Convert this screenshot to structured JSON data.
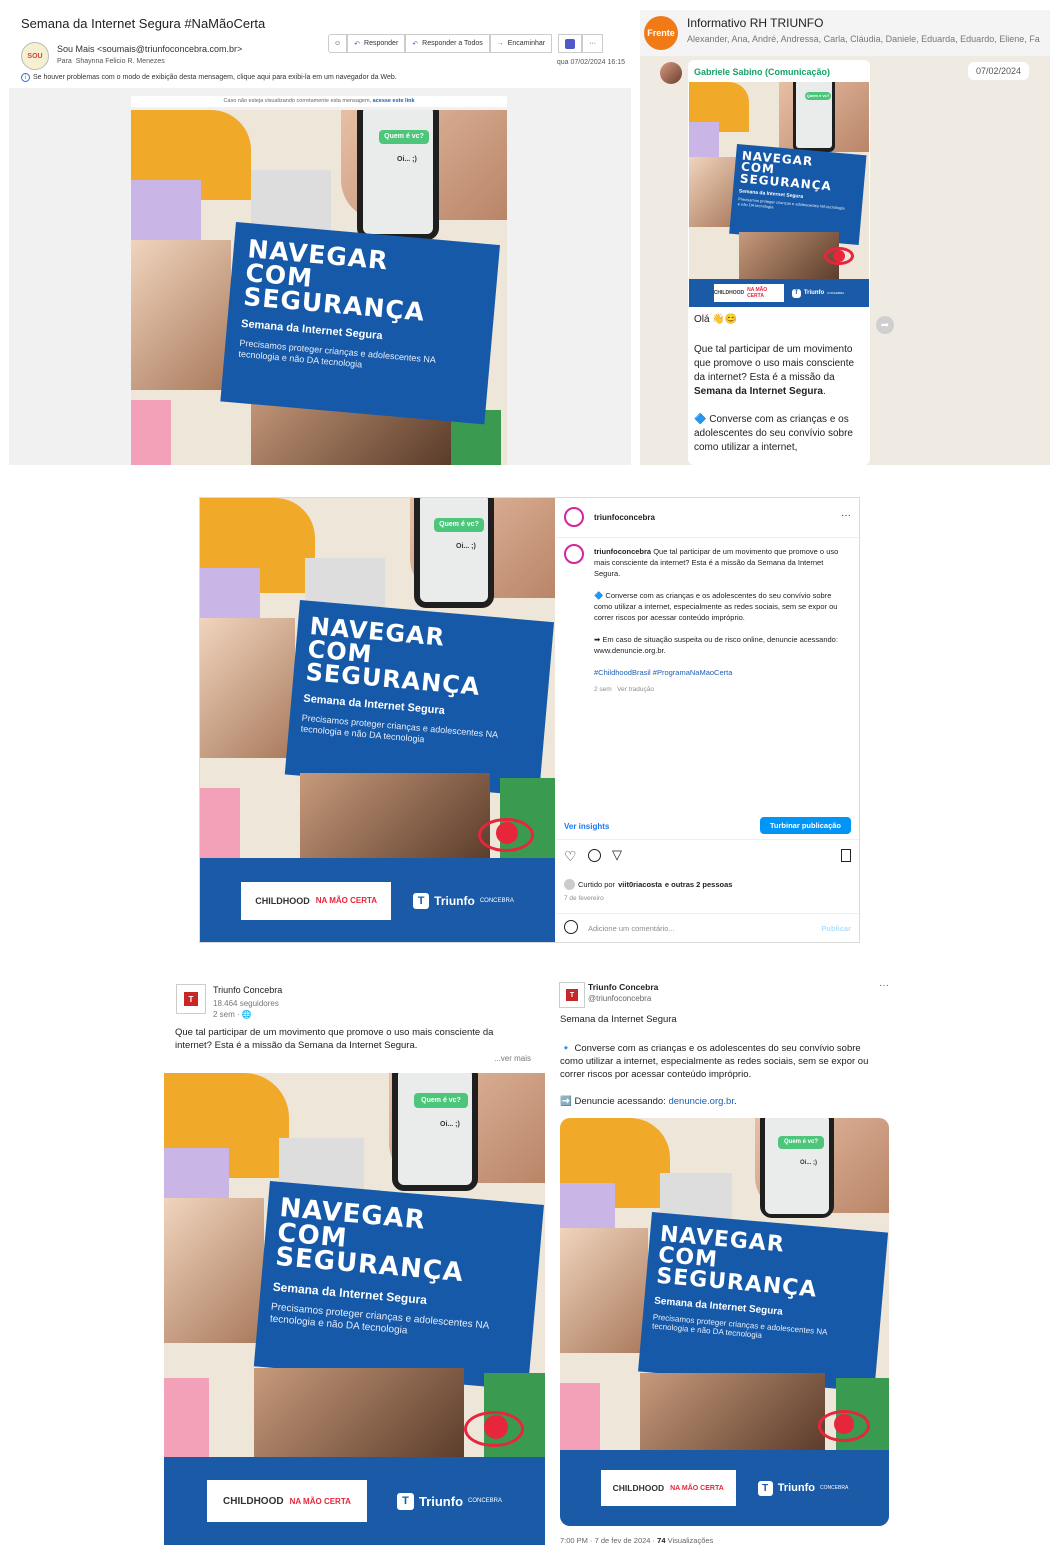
{
  "email": {
    "subject": "Semana da Internet Segura #NaMãoCerta",
    "from": "Sou Mais <soumais@triunfoconcebra.com.br>",
    "to_label": "Para",
    "to": "Shaynna Felicio R. Menezes",
    "actions": {
      "emoji": "☺",
      "reply": "Responder",
      "reply_all": "Responder a Todos",
      "forward": "Encaminhar",
      "more": "···"
    },
    "date": "qua 07/02/2024 16:15",
    "info": "Se houver problemas com o modo de exibição desta mensagem, clique aqui para exibi-la em um navegador da Web.",
    "banner_text": "Caso não esteja visualizando corretamente esta mensagem,",
    "banner_link": "acesse este link"
  },
  "poster": {
    "bubble_q": "Quem é vc?",
    "bubble_a": "Oi... ;)",
    "title": "NAVEGAR\nCOM\nSEGURANÇA",
    "subtitle": "Semana da Internet Segura",
    "desc": "Precisamos proteger crianças e adolescentes NA tecnologia e não DA tecnologia",
    "childhood": "CHILDHOOD",
    "program": "NA MÃO CERTA",
    "triunfo": "Triunfo",
    "concebra": "CONCEBRA"
  },
  "whatsapp": {
    "group_name": "Informativo RH TRIUNFO",
    "avatar_text": "Frente",
    "members": "Alexander, Ana, André, Andressa, Carla, Cláudia, Daniele, Eduarda, Eduardo, Eliene, Fa",
    "sender": "Gabriele Sabino (Comunicação)",
    "date_badge": "07/02/2024",
    "greeting": "Olá 👋😊",
    "para1_a": "Que tal participar de um movimento que promove o uso mais consciente da internet? Esta é a missão da ",
    "para1_b": "Semana da Internet Segura",
    "para1_c": ".",
    "para2": "🔷 Converse com as crianças e os adolescentes do seu convívio sobre como utilizar a internet,"
  },
  "instagram": {
    "username": "triunfoconcebra",
    "more": "···",
    "caption_lead": "Que tal participar de um movimento que promove o uso mais consciente da internet? Esta é a missão da Semana da Internet Segura.",
    "caption_p2": "🔷 Converse com as crianças e os adolescentes do seu convívio sobre como utilizar a internet, especialmente as redes sociais, sem se expor ou correr riscos por acessar conteúdo impróprio.",
    "caption_p3": "➡ Em caso de situação suspeita ou de risco online, denuncie acessando: www.denuncie.org.br.",
    "hashtags": "#ChildhoodBrasil #ProgramaNaMaoCerta",
    "time": "2 sem",
    "translate": "Ver tradução",
    "insights": "Ver insights",
    "boost": "Turbinar publicação",
    "liked_prefix": "Curtido por",
    "liked_user": "viit0riacosta",
    "liked_suffix": "e outras 2 pessoas",
    "date": "7 de fevereiro",
    "comment_placeholder": "Adicione um comentário...",
    "publish": "Publicar"
  },
  "facebook": {
    "page": "Triunfo Concebra",
    "followers": "18.464 seguidores",
    "time": "2 sem · 🌐",
    "text": "Que tal participar de um movimento que promove o uso mais consciente da internet? Esta é a missão da Semana da Internet Segura.",
    "see_more": "...ver mais"
  },
  "twitter": {
    "name": "Triunfo Concebra",
    "handle": "@triunfoconcebra",
    "more": "···",
    "line1": "Semana da Internet Segura",
    "line2": "🔹 Converse com as crianças e os adolescentes do seu convívio sobre como utilizar a internet, especialmente as redes sociais, sem se expor ou correr riscos por acessar conteúdo impróprio.",
    "line3_prefix": "➡️ Denuncie acessando: ",
    "line3_link": "denuncie.org.br",
    "line3_suffix": ".",
    "footer_time": "7:00 PM · 7 de fev de 2024 · ",
    "footer_views_num": "74",
    "footer_views": " Visualizações"
  }
}
